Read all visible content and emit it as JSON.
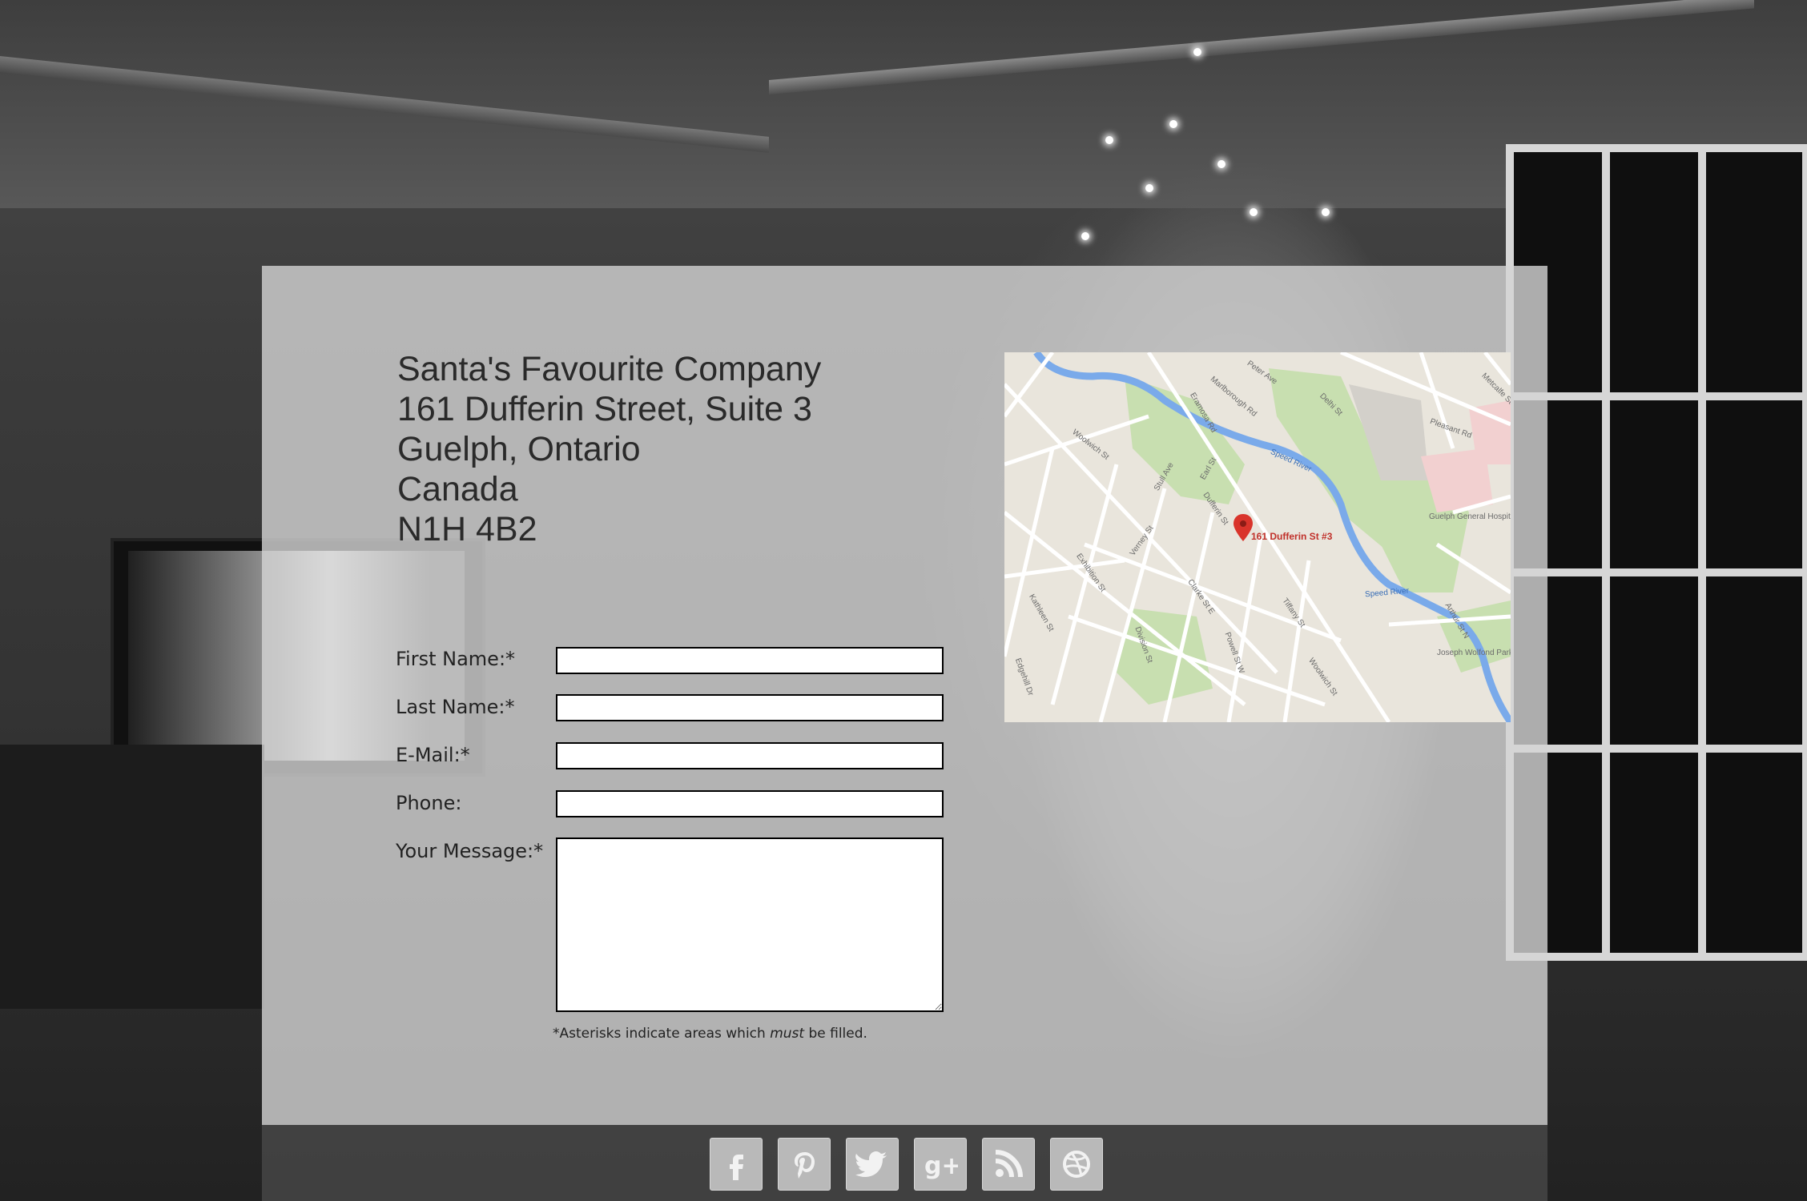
{
  "address": {
    "line1": "Santa's Favourite Company",
    "line2": "161 Dufferin Street, Suite 3",
    "line3": "Guelph, Ontario",
    "line4": "Canada",
    "line5": "N1H 4B2"
  },
  "form": {
    "first_name_label": "First Name:*",
    "last_name_label": "Last Name:*",
    "email_label": "E-Mail:*",
    "phone_label": "Phone:",
    "message_label": "Your Message:*",
    "first_name_value": "",
    "last_name_value": "",
    "email_value": "",
    "phone_value": "",
    "message_value": "",
    "note_prefix": "*Asterisks indicate areas which ",
    "note_emphasis": "must",
    "note_suffix": " be filled."
  },
  "map": {
    "pin_label": "161 Dufferin St #3",
    "streets": [
      "Woolwich St",
      "Speed River",
      "Guelph General Hospital",
      "Exhibition St",
      "Dufferin St",
      "Speed River",
      "Joseph Wolfond Park East",
      "Arthur St N",
      "Woolwich St",
      "Clarke St E",
      "Tiffany St",
      "Kathleen St",
      "Edgehill Dr",
      "Division St",
      "Powell St W",
      "Eramosa Rd",
      "Delhi St",
      "Metcalfe St",
      "Pleasant Rd",
      "Marlborough Rd",
      "Peter Ave",
      "Earl St",
      "Stull Ave",
      "Verney St"
    ],
    "colors": {
      "land": "#e9e5dc",
      "park": "#c8dfb0",
      "water": "#7aaaea",
      "hospital": "#f2d0d0",
      "road": "#ffffff",
      "pin": "#d9342b"
    }
  },
  "social": [
    {
      "name": "facebook-icon",
      "glyph": "f"
    },
    {
      "name": "pinterest-icon",
      "glyph": "p"
    },
    {
      "name": "twitter-icon",
      "glyph": "t"
    },
    {
      "name": "google-plus-icon",
      "glyph": "g+"
    },
    {
      "name": "rss-icon",
      "glyph": "rss"
    },
    {
      "name": "dribbble-icon",
      "glyph": "d"
    }
  ]
}
